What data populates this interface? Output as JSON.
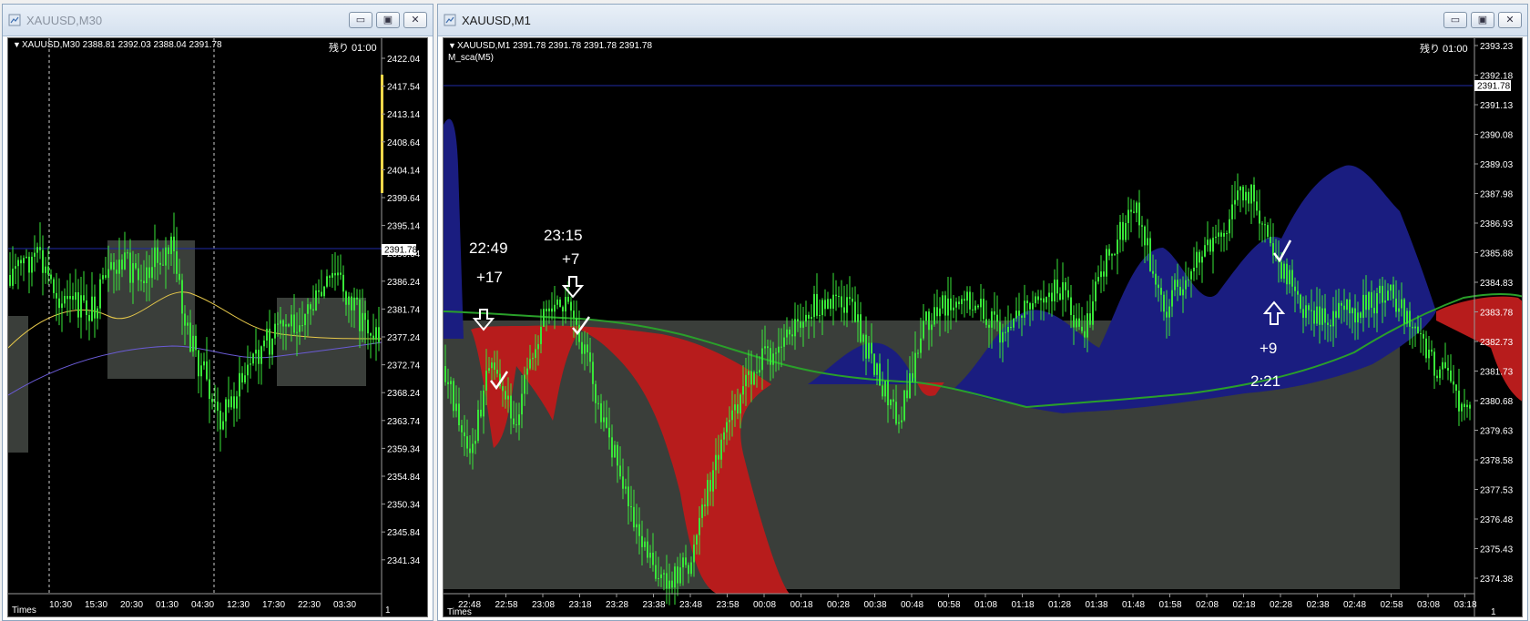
{
  "left_window": {
    "title": "XAUUSD,M30",
    "buttons": {
      "minimize": "▭",
      "maximize": "▣",
      "close": "✕"
    },
    "header_text": "XAUUSD,M30  2388.81 2392.03 2388.04 2391.78",
    "remaining": "残り 01:00",
    "price_labels": [
      "2422.04",
      "2417.54",
      "2413.14",
      "2408.64",
      "2404.14",
      "2399.64",
      "2395.14",
      "2391.78",
      "2390.64",
      "2386.24",
      "2381.74",
      "2377.24",
      "2372.74",
      "2368.24",
      "2363.74",
      "2359.34",
      "2354.84",
      "2350.34",
      "2345.84",
      "2341.34"
    ],
    "current_price": "2391.78",
    "time_labels": [
      "10:30",
      "15:30",
      "20:30",
      "01:30",
      "04:30",
      "12:30",
      "17:30",
      "22:30",
      "03:30"
    ],
    "times_label": "Times",
    "right_corner": "1"
  },
  "right_window": {
    "title": "XAUUSD,M1",
    "buttons": {
      "minimize": "▭",
      "maximize": "▣",
      "close": "✕"
    },
    "header_text": "XAUUSD,M1  2391.78 2391.78 2391.78 2391.78",
    "indicator_name": "M_sca(M5)",
    "remaining": "残り 01:00",
    "price_labels": [
      "2393.23",
      "2392.18",
      "2391.78",
      "2391.13",
      "2390.08",
      "2389.03",
      "2387.98",
      "2386.93",
      "2385.88",
      "2384.83",
      "2383.78",
      "2382.73",
      "2381.73",
      "2380.68",
      "2379.63",
      "2378.58",
      "2377.53",
      "2376.48",
      "2375.43",
      "2374.38"
    ],
    "current_price": "2391.78",
    "time_labels": [
      "22:48",
      "22:58",
      "23:08",
      "23:18",
      "23:28",
      "23:38",
      "23:48",
      "23:58",
      "00:08",
      "00:18",
      "00:28",
      "00:38",
      "00:48",
      "00:58",
      "01:08",
      "01:18",
      "01:28",
      "01:38",
      "01:48",
      "01:58",
      "02:08",
      "02:18",
      "02:28",
      "02:38",
      "02:48",
      "02:58",
      "03:08",
      "03:18"
    ],
    "times_label": "Times",
    "right_corner": "1",
    "annotations": {
      "a1_time": "22:49",
      "a1_pips": "+17",
      "a2_time": "23:15",
      "a2_pips": "+7",
      "a3_pips": "+9",
      "a3_time": "2:21"
    }
  },
  "colors": {
    "bull_candle": "#39e639",
    "cloud_red": "#b71c1c",
    "cloud_blue": "#1a1d80",
    "box_gray": "#3a3e3a",
    "ma_yellow": "#e6c84a",
    "ma_purple": "#6a5bd6"
  }
}
